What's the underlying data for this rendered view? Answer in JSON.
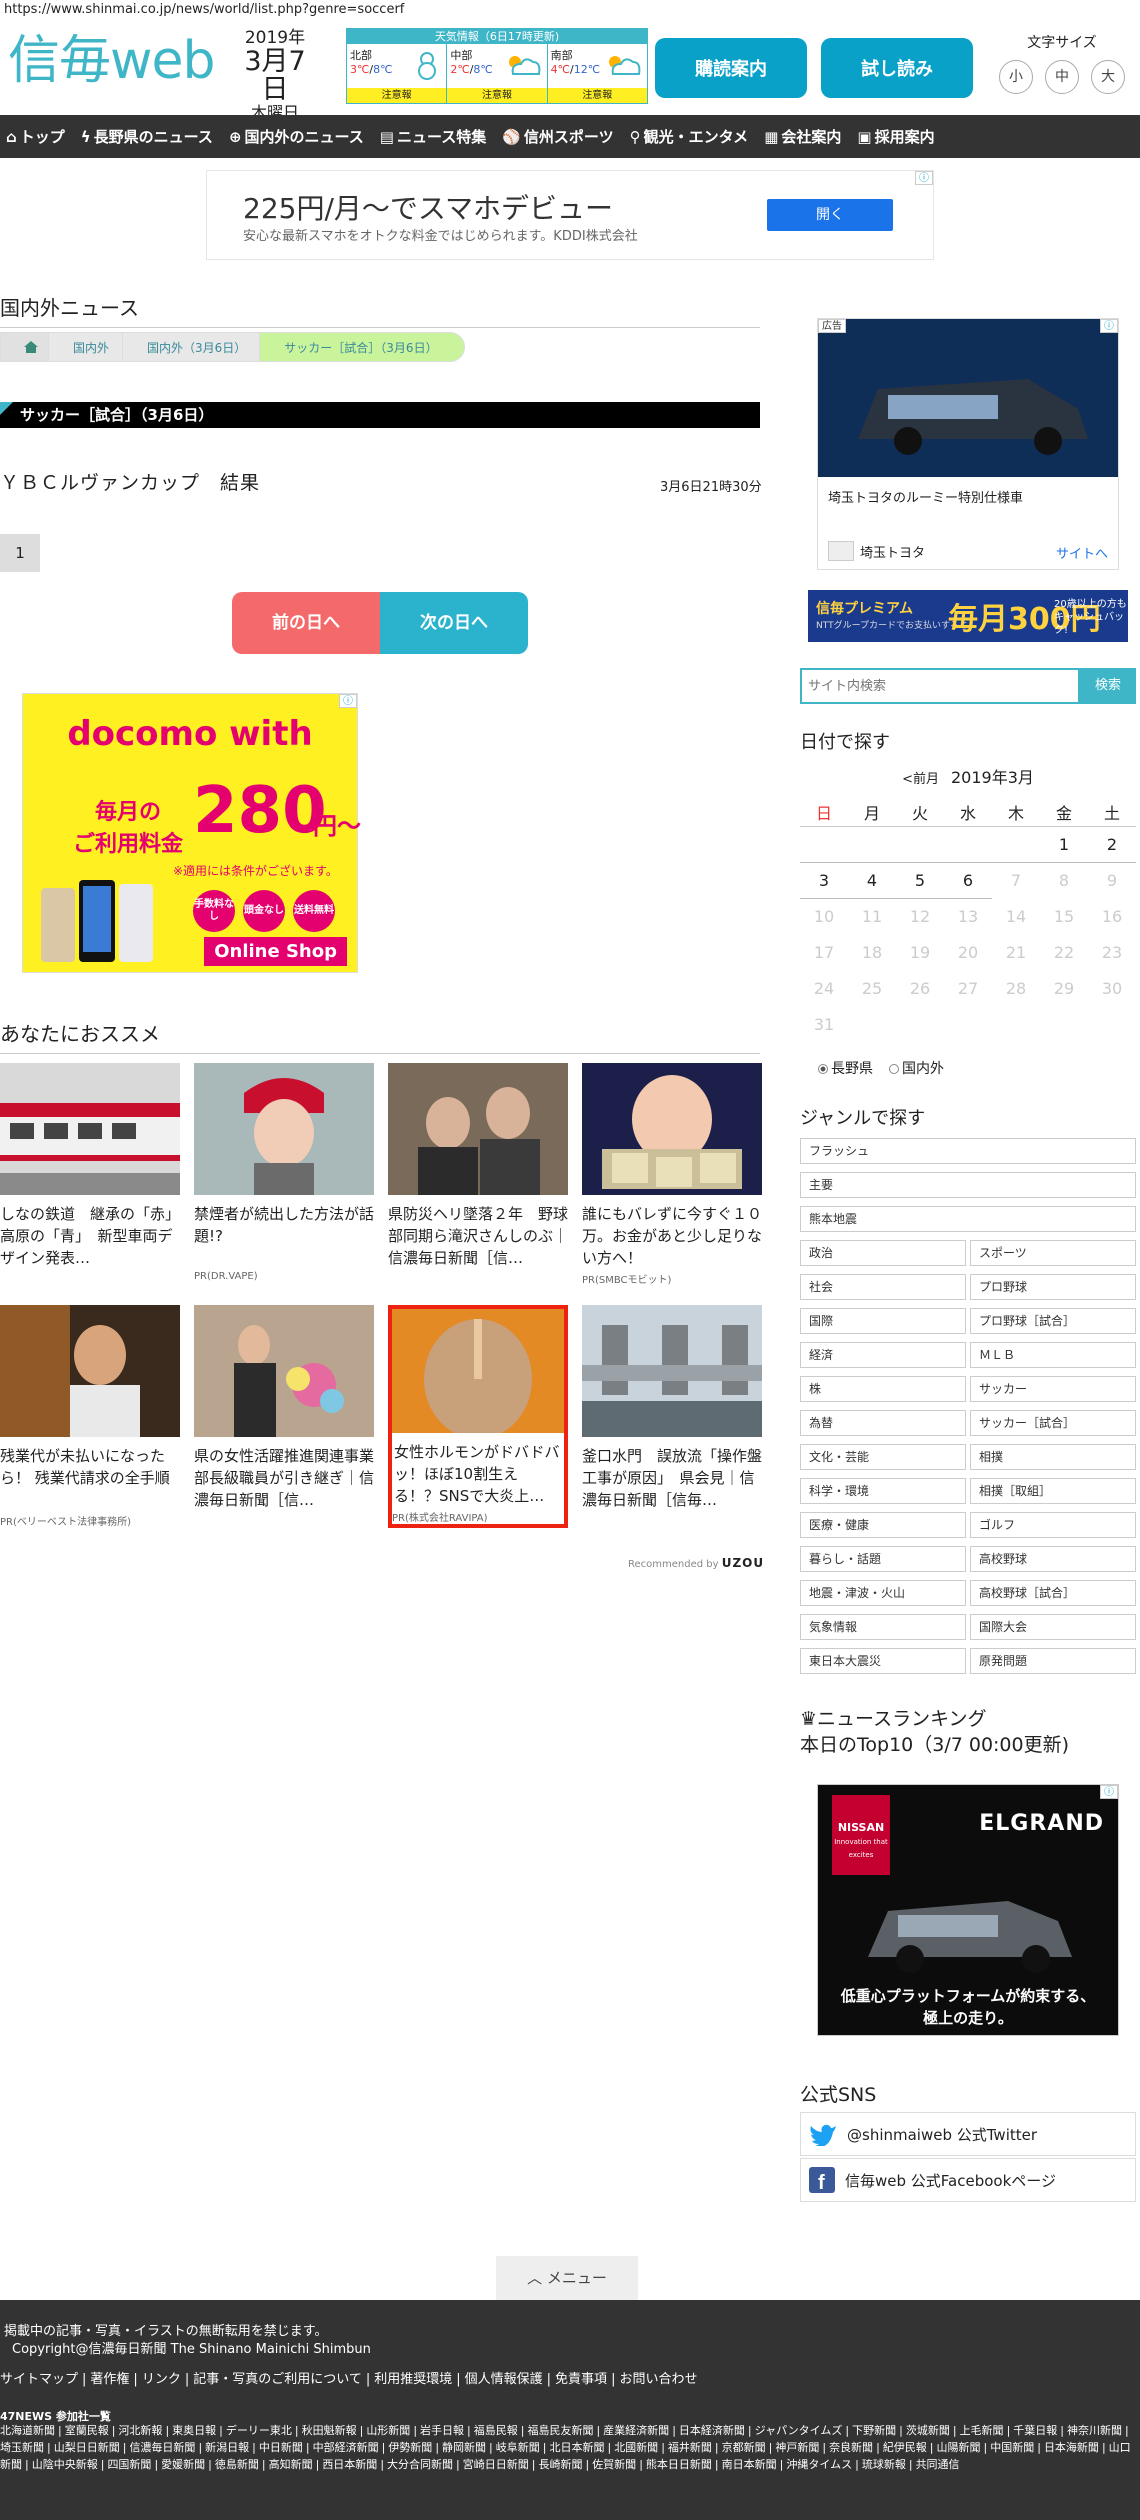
{
  "url": "https://www.shinmai.co.jp/news/world/list.php?genre=soccerf",
  "logo": "信毎web",
  "date": {
    "year": "2019年",
    "md": "3月7日",
    "weekday": "木曜日"
  },
  "weather": {
    "title": "天気情報（6日17時更新)",
    "regions": [
      {
        "name": "北部",
        "high": "3℃",
        "low": "8℃",
        "warn": "注意報"
      },
      {
        "name": "中部",
        "high": "2℃",
        "low": "8℃",
        "warn": "注意報"
      },
      {
        "name": "南部",
        "high": "4℃",
        "low": "12℃",
        "warn": "注意報"
      }
    ]
  },
  "header": {
    "subscribe": "購読案内",
    "trial": "試し読み",
    "fontsize_label": "文字サイズ",
    "sizes": [
      "小",
      "中",
      "大"
    ]
  },
  "nav": [
    "トップ",
    "長野県のニュース",
    "国内外のニュース",
    "ニュース特集",
    "信州スポーツ",
    "観光・エンタメ",
    "会社案内",
    "採用案内"
  ],
  "ad_top": {
    "title": "225円/月〜でスマホデビュー",
    "sub": "安心な最新スマホをオトクな料金ではじめられます。KDDI株式会社",
    "open": "開く"
  },
  "section": "国内外ニュース",
  "breadcrumb": [
    "国内外",
    "国内外（3月6日）",
    "サッカー［試合］（3月6日）"
  ],
  "category_bar": "サッカー［試合］（3月6日）",
  "article": {
    "title": "ＹＢＣルヴァンカップ　結果",
    "time": "3月6日21時30分"
  },
  "page_number": "1",
  "pager": {
    "prev": "前の日へ",
    "next": "次の日へ"
  },
  "docomo": {
    "brand": "docomo with",
    "monthly": "毎月の",
    "usage": "ご利用料金",
    "price": "280",
    "yen": "円〜",
    "note": "※適用には条件がございます。",
    "chips": [
      "手数料なし",
      "頭金なし",
      "送料無料"
    ],
    "shop": "Online Shop"
  },
  "recommend": {
    "title": "あなたにおススメ",
    "cards": [
      {
        "title": "しなの鉄道　継承の「赤」　高原の「青」　新型車両デザイン発表…",
        "pr": ""
      },
      {
        "title": "禁煙者が続出した方法が話題!?",
        "pr": "PR(DR.VAPE)"
      },
      {
        "title": "県防災ヘリ墜落２年　野球部同期ら滝沢さんしのぶ｜信濃毎日新聞［信…",
        "pr": ""
      },
      {
        "title": "誰にもバレずに今すぐ１０万。お金があと少し足りない方へ！",
        "pr": "PR(SMBCモビット)"
      },
      {
        "title": "残業代が未払いになったら！ 残業代請求の全手順",
        "pr": "PR(ベリーベスト法律事務所)"
      },
      {
        "title": "県の女性活躍推進関連事業　部長級職員が引き継ぎ｜信濃毎日新聞［信…",
        "pr": ""
      },
      {
        "title": "女性ホルモンがドバドバッ！ほぼ10割生える！？SNSで大炎上…",
        "pr": "PR(株式会社RAVIPA)"
      },
      {
        "title": "釜口水門　誤放流「操作盤工事が原因」　県会見｜信濃毎日新聞［信毎…",
        "pr": ""
      }
    ],
    "by": "Recommended by",
    "brand": "UZOU"
  },
  "side_ad": {
    "label": "広告",
    "title": "埼玉トヨタのルーミー特別仕様車",
    "sponsor": "埼玉トヨタ",
    "link": "サイトへ"
  },
  "premium": {
    "name": "信毎プレミアム",
    "sub": "NTTグループカードでお支払いすると",
    "price": "毎月300円",
    "tag": "20歳以上の方も キャッシュバック!"
  },
  "search": {
    "placeholder": "サイト内検索",
    "button": "検索"
  },
  "calendar": {
    "title": "日付で探す",
    "prev": "<前月",
    "month": "2019年3月",
    "days": [
      "日",
      "月",
      "火",
      "水",
      "木",
      "金",
      "土"
    ],
    "weeks": [
      [
        "",
        "",
        "",
        "",
        "",
        "1",
        "2"
      ],
      [
        "3",
        "4",
        "5",
        "6",
        "7",
        "8",
        "9"
      ],
      [
        "10",
        "11",
        "12",
        "13",
        "14",
        "15",
        "16"
      ],
      [
        "17",
        "18",
        "19",
        "20",
        "21",
        "22",
        "23"
      ],
      [
        "24",
        "25",
        "26",
        "27",
        "28",
        "29",
        "30"
      ],
      [
        "31",
        "",
        "",
        "",
        "",
        "",
        ""
      ]
    ],
    "radio": [
      "長野県",
      "国内外"
    ]
  },
  "genre": {
    "title": "ジャンルで探す",
    "wide": [
      "フラッシュ",
      "主要",
      "熊本地震"
    ],
    "pairs": [
      "政治",
      "スポーツ",
      "社会",
      "プロ野球",
      "国際",
      "プロ野球［試合］",
      "経済",
      "ＭＬＢ",
      "株",
      "サッカー",
      "為替",
      "サッカー［試合］",
      "文化・芸能",
      "相撲",
      "科学・環境",
      "相撲［取組］",
      "医療・健康",
      "ゴルフ",
      "暮らし・話題",
      "高校野球",
      "地震・津波・火山",
      "高校野球［試合］",
      "気象情報",
      "国際大会",
      "東日本大震災",
      "原発問題"
    ]
  },
  "ranking": {
    "title": "ニュースランキング",
    "sub": "本日のTop10（3/7 00:00更新)"
  },
  "nissan": {
    "brand": "NISSAN",
    "tag": "Innovation that excites",
    "model": "ELGRAND",
    "copy": "低重心プラットフォームが約束する、\n極上の走り。"
  },
  "sns": {
    "title": "公式SNS",
    "twitter": "@shinmaiweb 公式Twitter",
    "facebook": "信毎web 公式Facebookページ"
  },
  "menu": "メニュー",
  "footer": {
    "notice": "掲載中の記事・写真・イラストの無断転用を禁じます。",
    "copyright": "Copyright@信濃毎日新聞 The Shinano Mainichi Shimbun",
    "links": [
      "サイトマップ",
      "著作権",
      "リンク",
      "記事・写真のご利用について",
      "利用推奨環境",
      "個人情報保護",
      "免責事項",
      "お問い合わせ"
    ],
    "group": "47NEWS 参加社一覧",
    "papers": [
      "北海道新聞",
      "室蘭民報",
      "河北新報",
      "東奥日報",
      "デーリー東北",
      "秋田魁新報",
      "山形新聞",
      "岩手日報",
      "福島民報",
      "福島民友新聞",
      "産業経済新聞",
      "日本経済新聞",
      "ジャパンタイムズ",
      "下野新聞",
      "茨城新聞",
      "上毛新聞",
      "千葉日報",
      "神奈川新聞",
      "埼玉新聞",
      "山梨日日新聞",
      "信濃毎日新聞",
      "新潟日報",
      "中日新聞",
      "中部経済新聞",
      "伊勢新聞",
      "静岡新聞",
      "岐阜新聞",
      "北日本新聞",
      "北國新聞",
      "福井新聞",
      "京都新聞",
      "神戸新聞",
      "奈良新聞",
      "紀伊民報",
      "山陽新聞",
      "中国新聞",
      "日本海新聞",
      "山口新聞",
      "山陰中央新報",
      "四国新聞",
      "愛媛新聞",
      "徳島新聞",
      "高知新聞",
      "西日本新聞",
      "大分合同新聞",
      "宮崎日日新聞",
      "長崎新聞",
      "佐賀新聞",
      "熊本日日新聞",
      "南日本新聞",
      "沖縄タイムス",
      "琉球新報",
      "共同通信"
    ]
  }
}
